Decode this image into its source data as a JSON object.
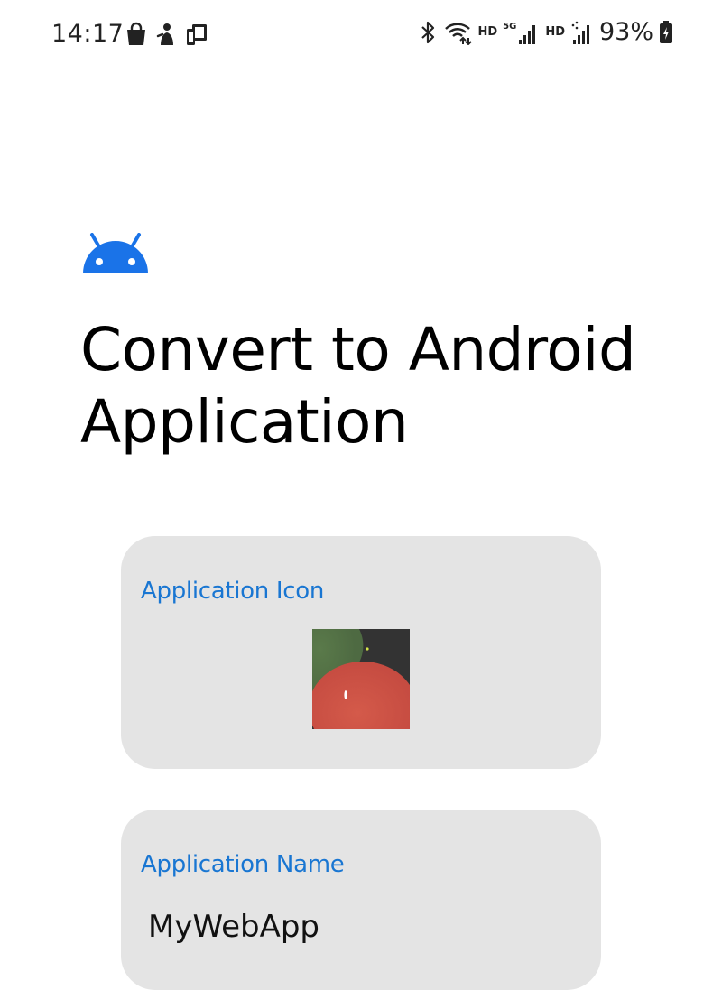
{
  "status_bar": {
    "time": "14:17",
    "left_icons": [
      "shopping-bag-icon",
      "notification-icon",
      "device-icon"
    ],
    "right_icons": [
      "bluetooth-icon",
      "wifi-icon",
      "signal-icon",
      "signal-icon"
    ],
    "hd_label_1": "HD",
    "network_label": "5G",
    "hd_label_2": "HD",
    "battery": "93%"
  },
  "header": {
    "logo_icon": "android-icon",
    "title": "Convert to Android Application"
  },
  "icon_card": {
    "label": "Application Icon"
  },
  "name_card": {
    "label": "Application Name",
    "value": "MyWebApp"
  },
  "colors": {
    "accent": "#1976d2",
    "android_logo": "#1a73e8",
    "card_background": "#e4e4e4"
  }
}
